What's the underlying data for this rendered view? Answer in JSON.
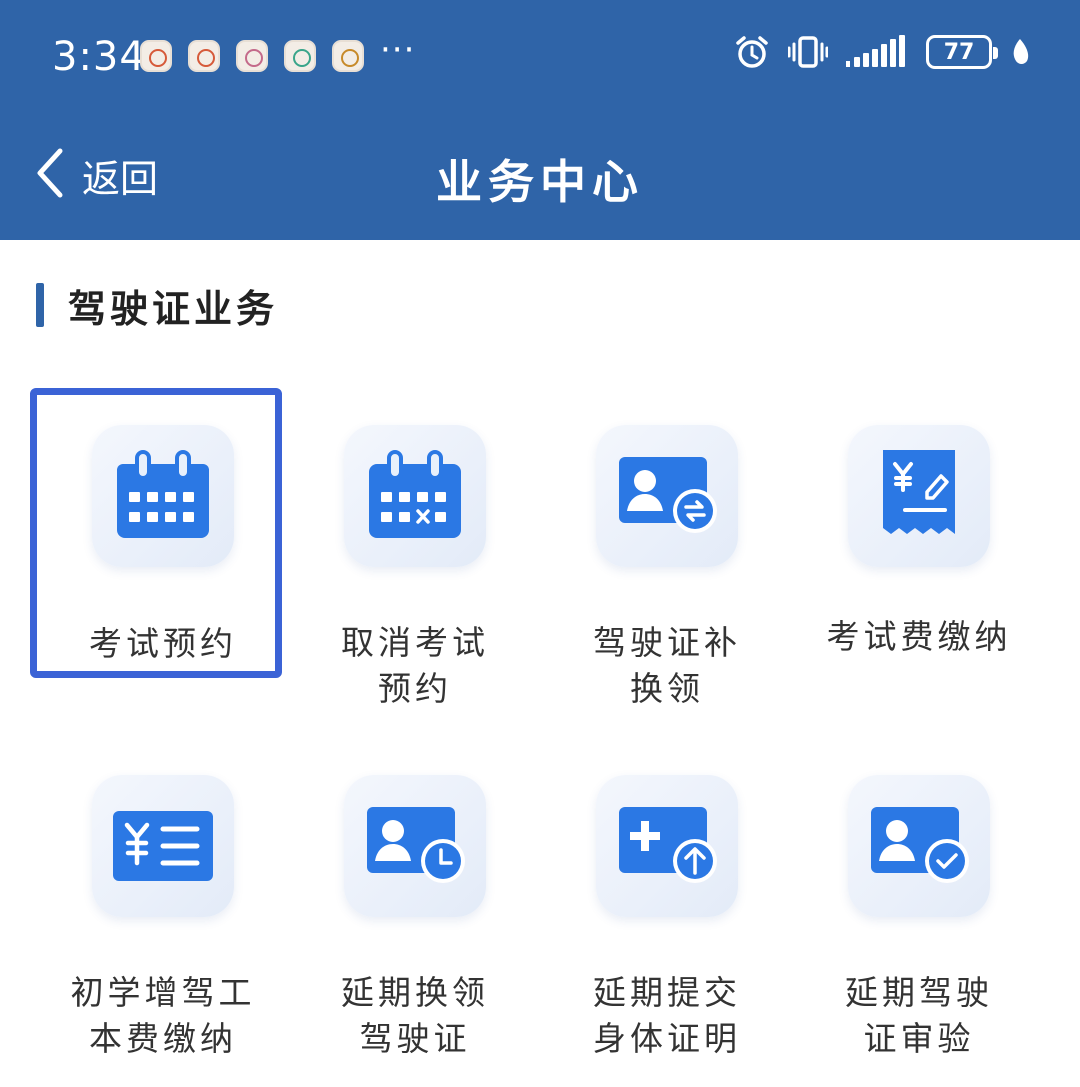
{
  "status_bar": {
    "time": "3:34",
    "more_notifications": "···",
    "battery_level": "77"
  },
  "navbar": {
    "back_label": "返回",
    "title": "业务中心"
  },
  "section": {
    "title": "驾驶证业务"
  },
  "services": [
    {
      "label": "考试预约",
      "icon": "calendar-icon",
      "selected": true
    },
    {
      "label": "取消考试\n预约",
      "icon": "calendar-cancel-icon",
      "selected": false
    },
    {
      "label": "驾驶证补\n换领",
      "icon": "license-exchange-icon",
      "selected": false
    },
    {
      "label": "考试费缴纳",
      "icon": "receipt-yuan-icon",
      "selected": false
    },
    {
      "label": "初学增驾工\n本费缴纳",
      "icon": "yuan-list-icon",
      "selected": false
    },
    {
      "label": "延期换领\n驾驶证",
      "icon": "license-clock-icon",
      "selected": false
    },
    {
      "label": "延期提交\n身体证明",
      "icon": "medical-upload-icon",
      "selected": false
    },
    {
      "label": "延期驾驶\n证审验",
      "icon": "license-check-icon",
      "selected": false
    }
  ],
  "colors": {
    "header_bg": "#2f64a8",
    "icon_blue": "#2b78e4",
    "selection_border": "#3b63d6"
  }
}
